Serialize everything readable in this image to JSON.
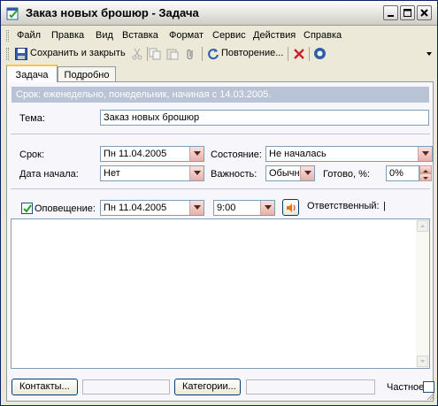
{
  "window": {
    "title": "Заказ новых брошюр - Задача"
  },
  "menu": {
    "items": [
      "Файл",
      "Правка",
      "Вид",
      "Вставка",
      "Формат",
      "Сервис",
      "Действия",
      "Справка"
    ]
  },
  "toolbar": {
    "save_close_label": "Сохранить и закрыть",
    "recurrence_label": "Повторение..."
  },
  "tabs": [
    {
      "label": "Задача",
      "active": true
    },
    {
      "label": "Подробно",
      "active": false
    }
  ],
  "info_bar": "Срок: еженедельно, понедельник, начиная с 14.03.2005.",
  "form": {
    "subject_label": "Тема:",
    "subject_value": "Заказ новых брошюр",
    "due_label": "Срок:",
    "due_value": "Пн 11.04.2005",
    "start_label": "Дата начала:",
    "start_value": "Нет",
    "status_label": "Состояние:",
    "status_value": "Не началась",
    "priority_label": "Важность:",
    "priority_value": "Обычная",
    "percent_label": "Готово, %:",
    "percent_value": "0%",
    "reminder_checked": true,
    "reminder_label": "Оповещение:",
    "reminder_date": "Пн 11.04.2005",
    "reminder_time": "9:00",
    "owner_label": "Ответственный:",
    "owner_value": "|"
  },
  "footer": {
    "contacts_button": "Контакты...",
    "categories_button": "Категории...",
    "private_label": "Частное",
    "private_checked": false
  },
  "colors": {
    "info_bar_bg": "#b9c3d6",
    "tab_highlight": "#ffc83c",
    "window_bg": "#ece9d8"
  }
}
